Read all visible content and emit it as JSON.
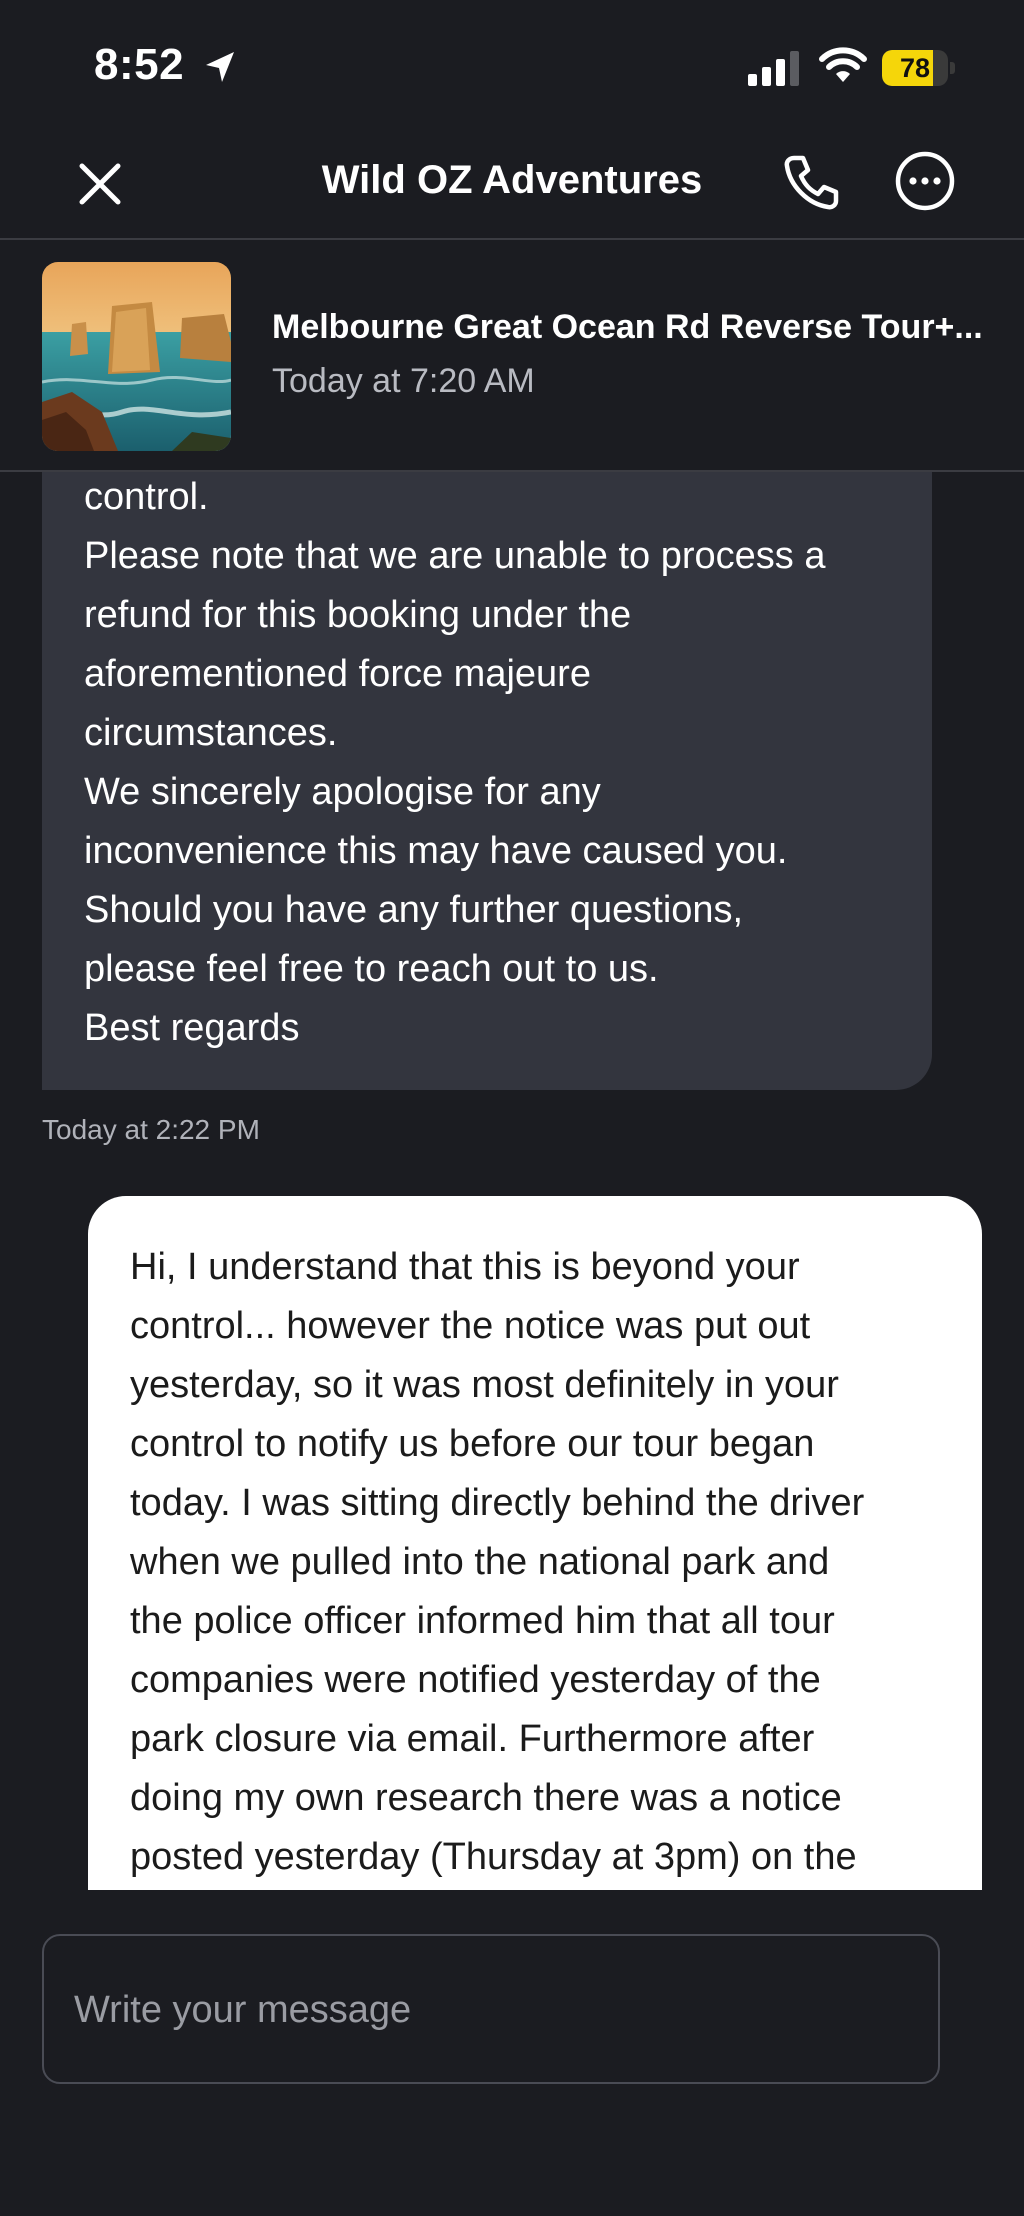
{
  "status_bar": {
    "time": "8:52",
    "battery_level": "78",
    "battery_fraction": 0.78,
    "icons": [
      "location-arrow-icon",
      "cellular-signal-icon",
      "wifi-icon",
      "battery-icon"
    ]
  },
  "header": {
    "title": "Wild OZ Adventures",
    "icons": [
      "close-icon",
      "phone-icon",
      "more-options-icon"
    ]
  },
  "booking": {
    "title": "Melbourne Great Ocean Rd Reverse Tour+...",
    "time": "Today at 7:20 AM"
  },
  "messages": {
    "incoming_text": "control.\nPlease note that we are unable to process a\nrefund for this booking under the\naforementioned force majeure\ncircumstances.\nWe sincerely apologise for any\ninconvenience this may have caused you.\nShould you have any further questions,\nplease feel free to reach out to us.\nBest regards",
    "incoming_time": "Today at 2:22 PM",
    "outgoing_text": "Hi, I understand that this is beyond your\ncontrol... however the notice was put out\nyesterday, so it was most definitely in your\ncontrol to notify us before our tour began\ntoday. I was sitting directly behind the driver\nwhen we pulled into the national park and\nthe police officer informed him that all tour\ncompanies were notified yesterday of the\npark closure via email. Furthermore after\ndoing my own research there was a notice\nposted yesterday (Thursday at 3pm) on the"
  },
  "composer": {
    "placeholder": "Write your message",
    "value": ""
  },
  "colors": {
    "background": "#1b1c21",
    "incoming_bubble": "#33353e",
    "outgoing_bubble": "#ffffff",
    "battery": "#f5d60a"
  }
}
